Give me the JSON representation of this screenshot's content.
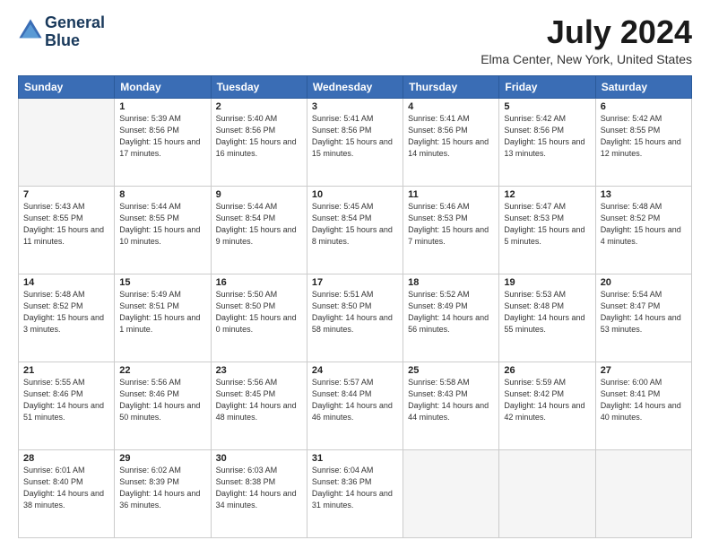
{
  "header": {
    "logo_line1": "General",
    "logo_line2": "Blue",
    "month_title": "July 2024",
    "location": "Elma Center, New York, United States"
  },
  "days_of_week": [
    "Sunday",
    "Monday",
    "Tuesday",
    "Wednesday",
    "Thursday",
    "Friday",
    "Saturday"
  ],
  "weeks": [
    [
      {
        "day": "",
        "sunrise": "",
        "sunset": "",
        "daylight": ""
      },
      {
        "day": "1",
        "sunrise": "Sunrise: 5:39 AM",
        "sunset": "Sunset: 8:56 PM",
        "daylight": "Daylight: 15 hours and 17 minutes."
      },
      {
        "day": "2",
        "sunrise": "Sunrise: 5:40 AM",
        "sunset": "Sunset: 8:56 PM",
        "daylight": "Daylight: 15 hours and 16 minutes."
      },
      {
        "day": "3",
        "sunrise": "Sunrise: 5:41 AM",
        "sunset": "Sunset: 8:56 PM",
        "daylight": "Daylight: 15 hours and 15 minutes."
      },
      {
        "day": "4",
        "sunrise": "Sunrise: 5:41 AM",
        "sunset": "Sunset: 8:56 PM",
        "daylight": "Daylight: 15 hours and 14 minutes."
      },
      {
        "day": "5",
        "sunrise": "Sunrise: 5:42 AM",
        "sunset": "Sunset: 8:56 PM",
        "daylight": "Daylight: 15 hours and 13 minutes."
      },
      {
        "day": "6",
        "sunrise": "Sunrise: 5:42 AM",
        "sunset": "Sunset: 8:55 PM",
        "daylight": "Daylight: 15 hours and 12 minutes."
      }
    ],
    [
      {
        "day": "7",
        "sunrise": "Sunrise: 5:43 AM",
        "sunset": "Sunset: 8:55 PM",
        "daylight": "Daylight: 15 hours and 11 minutes."
      },
      {
        "day": "8",
        "sunrise": "Sunrise: 5:44 AM",
        "sunset": "Sunset: 8:55 PM",
        "daylight": "Daylight: 15 hours and 10 minutes."
      },
      {
        "day": "9",
        "sunrise": "Sunrise: 5:44 AM",
        "sunset": "Sunset: 8:54 PM",
        "daylight": "Daylight: 15 hours and 9 minutes."
      },
      {
        "day": "10",
        "sunrise": "Sunrise: 5:45 AM",
        "sunset": "Sunset: 8:54 PM",
        "daylight": "Daylight: 15 hours and 8 minutes."
      },
      {
        "day": "11",
        "sunrise": "Sunrise: 5:46 AM",
        "sunset": "Sunset: 8:53 PM",
        "daylight": "Daylight: 15 hours and 7 minutes."
      },
      {
        "day": "12",
        "sunrise": "Sunrise: 5:47 AM",
        "sunset": "Sunset: 8:53 PM",
        "daylight": "Daylight: 15 hours and 5 minutes."
      },
      {
        "day": "13",
        "sunrise": "Sunrise: 5:48 AM",
        "sunset": "Sunset: 8:52 PM",
        "daylight": "Daylight: 15 hours and 4 minutes."
      }
    ],
    [
      {
        "day": "14",
        "sunrise": "Sunrise: 5:48 AM",
        "sunset": "Sunset: 8:52 PM",
        "daylight": "Daylight: 15 hours and 3 minutes."
      },
      {
        "day": "15",
        "sunrise": "Sunrise: 5:49 AM",
        "sunset": "Sunset: 8:51 PM",
        "daylight": "Daylight: 15 hours and 1 minute."
      },
      {
        "day": "16",
        "sunrise": "Sunrise: 5:50 AM",
        "sunset": "Sunset: 8:50 PM",
        "daylight": "Daylight: 15 hours and 0 minutes."
      },
      {
        "day": "17",
        "sunrise": "Sunrise: 5:51 AM",
        "sunset": "Sunset: 8:50 PM",
        "daylight": "Daylight: 14 hours and 58 minutes."
      },
      {
        "day": "18",
        "sunrise": "Sunrise: 5:52 AM",
        "sunset": "Sunset: 8:49 PM",
        "daylight": "Daylight: 14 hours and 56 minutes."
      },
      {
        "day": "19",
        "sunrise": "Sunrise: 5:53 AM",
        "sunset": "Sunset: 8:48 PM",
        "daylight": "Daylight: 14 hours and 55 minutes."
      },
      {
        "day": "20",
        "sunrise": "Sunrise: 5:54 AM",
        "sunset": "Sunset: 8:47 PM",
        "daylight": "Daylight: 14 hours and 53 minutes."
      }
    ],
    [
      {
        "day": "21",
        "sunrise": "Sunrise: 5:55 AM",
        "sunset": "Sunset: 8:46 PM",
        "daylight": "Daylight: 14 hours and 51 minutes."
      },
      {
        "day": "22",
        "sunrise": "Sunrise: 5:56 AM",
        "sunset": "Sunset: 8:46 PM",
        "daylight": "Daylight: 14 hours and 50 minutes."
      },
      {
        "day": "23",
        "sunrise": "Sunrise: 5:56 AM",
        "sunset": "Sunset: 8:45 PM",
        "daylight": "Daylight: 14 hours and 48 minutes."
      },
      {
        "day": "24",
        "sunrise": "Sunrise: 5:57 AM",
        "sunset": "Sunset: 8:44 PM",
        "daylight": "Daylight: 14 hours and 46 minutes."
      },
      {
        "day": "25",
        "sunrise": "Sunrise: 5:58 AM",
        "sunset": "Sunset: 8:43 PM",
        "daylight": "Daylight: 14 hours and 44 minutes."
      },
      {
        "day": "26",
        "sunrise": "Sunrise: 5:59 AM",
        "sunset": "Sunset: 8:42 PM",
        "daylight": "Daylight: 14 hours and 42 minutes."
      },
      {
        "day": "27",
        "sunrise": "Sunrise: 6:00 AM",
        "sunset": "Sunset: 8:41 PM",
        "daylight": "Daylight: 14 hours and 40 minutes."
      }
    ],
    [
      {
        "day": "28",
        "sunrise": "Sunrise: 6:01 AM",
        "sunset": "Sunset: 8:40 PM",
        "daylight": "Daylight: 14 hours and 38 minutes."
      },
      {
        "day": "29",
        "sunrise": "Sunrise: 6:02 AM",
        "sunset": "Sunset: 8:39 PM",
        "daylight": "Daylight: 14 hours and 36 minutes."
      },
      {
        "day": "30",
        "sunrise": "Sunrise: 6:03 AM",
        "sunset": "Sunset: 8:38 PM",
        "daylight": "Daylight: 14 hours and 34 minutes."
      },
      {
        "day": "31",
        "sunrise": "Sunrise: 6:04 AM",
        "sunset": "Sunset: 8:36 PM",
        "daylight": "Daylight: 14 hours and 31 minutes."
      },
      {
        "day": "",
        "sunrise": "",
        "sunset": "",
        "daylight": ""
      },
      {
        "day": "",
        "sunrise": "",
        "sunset": "",
        "daylight": ""
      },
      {
        "day": "",
        "sunrise": "",
        "sunset": "",
        "daylight": ""
      }
    ]
  ]
}
